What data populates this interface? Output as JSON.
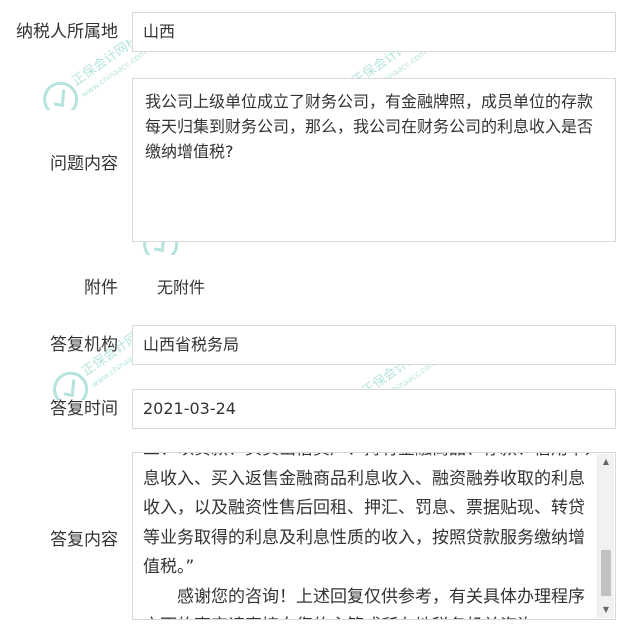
{
  "watermark": {
    "brand": "正保会计网校",
    "url": "www.chinaacc.com"
  },
  "form": {
    "region": {
      "label": "纳税人所属地",
      "value": "山西"
    },
    "question": {
      "label": "问题内容",
      "value": "我公司上级单位成立了财务公司，有金融牌照，成员单位的存款每天归集到财务公司，那么，我公司在财务公司的利息收入是否缴纳增值税?"
    },
    "attachment": {
      "label": "附件",
      "value": "无附件"
    },
    "agency": {
      "label": "答复机构",
      "value": "山西省税务局"
    },
    "date": {
      "label": "答复时间",
      "value": "2021-03-24"
    },
    "answer": {
      "label": "答复内容",
      "partial_line": "三、以贷款、买卖出借资产、持有金融商品、存款、信用卡透支等利",
      "paragraph": "息收入、买入返售金融商品利息收入、融资融券收取的利息收入，以及融资性售后回租、押汇、罚息、票据贴现、转贷等业务取得的利息及利息性质的收入，按照贷款服务缴纳增值税。”",
      "closing": "感谢您的咨询！上述回复仅供参考，有关具体办理程序方面的事宜请直接向您的主管或所在地税务机关咨询。"
    }
  },
  "colors": {
    "border": "#d9d9d9",
    "text": "#333333",
    "watermark": "#2bb5a0"
  }
}
